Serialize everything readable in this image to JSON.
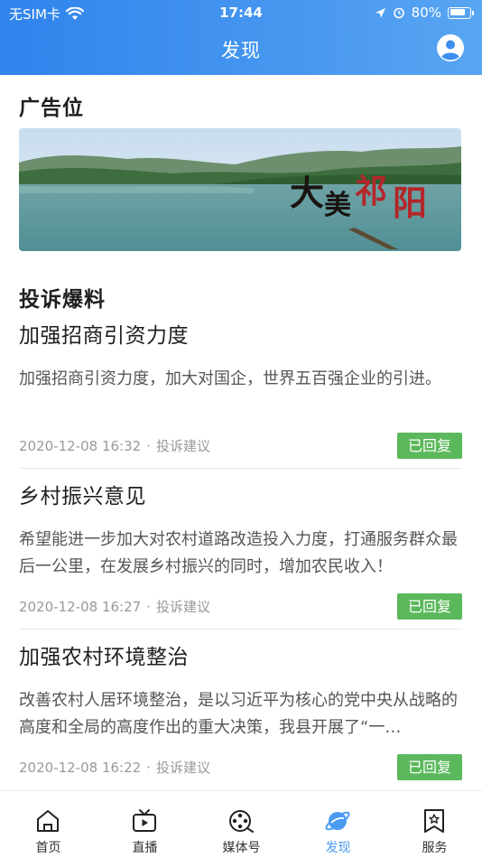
{
  "status_bar": {
    "carrier": "无SIM卡",
    "time": "17:44",
    "battery_percent": "80%",
    "battery_level": 0.8
  },
  "header": {
    "title": "发现",
    "profile_icon": "user-circle-icon"
  },
  "ad_section": {
    "title": "广告位",
    "banner_text": "大美祁阳"
  },
  "complaints": {
    "title": "投诉爆料",
    "items": [
      {
        "title": "加强招商引资力度",
        "body": "加强招商引资力度，加大对国企，世界五百强企业的引进。",
        "date": "2020-12-08 16:32",
        "category": "投诉建议",
        "status": "已回复"
      },
      {
        "title": "乡村振兴意见",
        "body": "希望能进一步加大对农村道路改造投入力度，打通服务群众最后一公里，在发展乡村振兴的同时，增加农民收入！",
        "date": "2020-12-08 16:27",
        "category": "投诉建议",
        "status": "已回复"
      },
      {
        "title": "加强农村环境整治",
        "body": "改善农村人居环境整治，是以习近平为核心的党中央从战略的高度和全局的高度作出的重大决策，我县开展了“一…",
        "date": "2020-12-08 16:22",
        "category": "投诉建议",
        "status": "已回复"
      }
    ]
  },
  "tabbar": {
    "items": [
      {
        "label": "首页",
        "icon": "home-icon"
      },
      {
        "label": "直播",
        "icon": "tv-icon"
      },
      {
        "label": "媒体号",
        "icon": "film-reel-icon"
      },
      {
        "label": "发现",
        "icon": "planet-icon",
        "active": true
      },
      {
        "label": "服务",
        "icon": "bookmark-star-icon"
      }
    ]
  },
  "colors": {
    "header_start": "#2f83ec",
    "header_end": "#58a5f2",
    "badge_green": "#5cb85c",
    "tab_active": "#4a9bf0"
  }
}
